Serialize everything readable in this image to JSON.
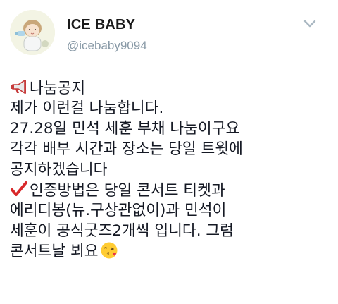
{
  "tweet": {
    "display_name": "ICE BABY",
    "handle": "@icebaby9094",
    "lines": [
      "나눔공지",
      "제가 이런걸 나눔합니다.",
      "27.28일 민석 세훈 부채 나눔이구요",
      "각각 배부 시간과 장소는 당일 트윗에",
      "공지하겠습니다",
      "인증방법은 당일 콘서트 티켓과",
      "에리디봉(뉴.구상관없이)과 민석이",
      "세훈이 공식굿즈2개씩 입니다. 그럼",
      "콘서트날 뵈요"
    ],
    "icons": {
      "line0_prefix": "megaphone-icon",
      "line5_prefix": "check-mark-icon",
      "line8_suffix": "kiss-face-icon",
      "menu": "chevron-down-icon"
    }
  },
  "colors": {
    "text": "#141823",
    "handle": "#8899a6",
    "check_red": "#d8282a"
  }
}
